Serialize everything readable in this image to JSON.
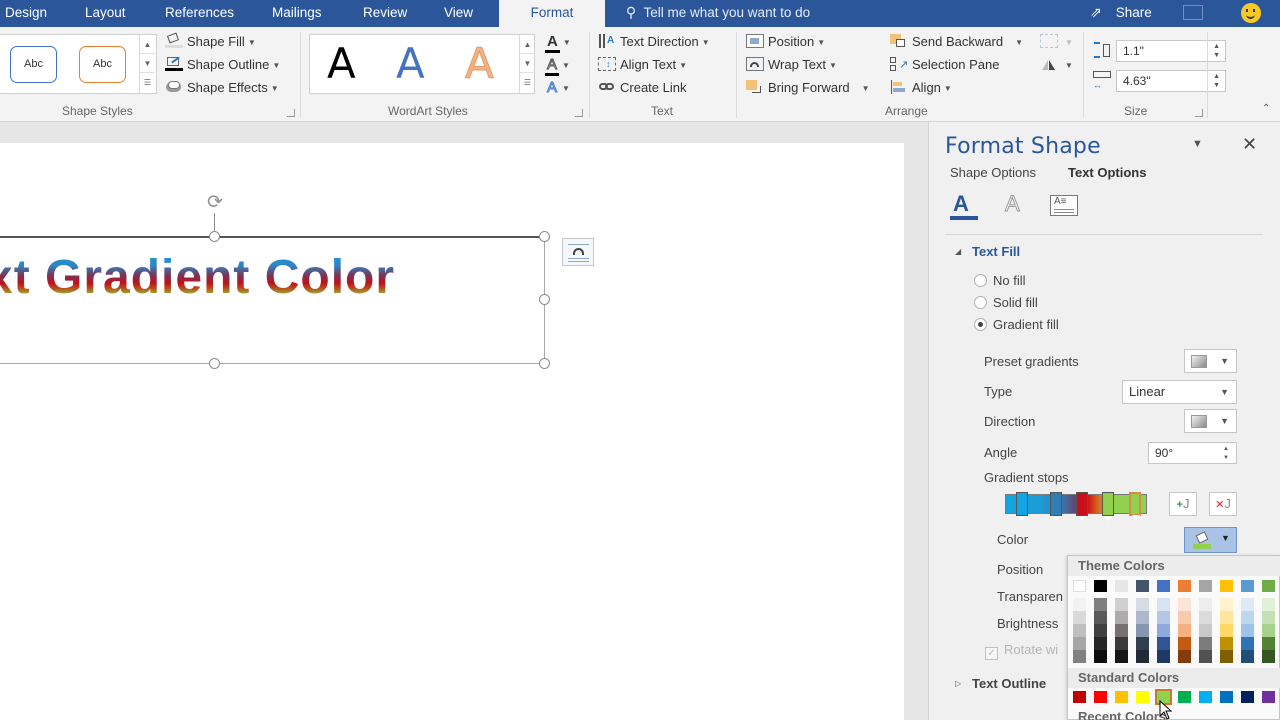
{
  "tabs": [
    {
      "label": "Design",
      "active": false
    },
    {
      "label": "Layout",
      "active": false
    },
    {
      "label": "References",
      "active": false
    },
    {
      "label": "Mailings",
      "active": false
    },
    {
      "label": "Review",
      "active": false
    },
    {
      "label": "View",
      "active": false
    },
    {
      "label": "Format",
      "active": true
    }
  ],
  "tell_me": {
    "placeholder": "Tell me what you want to do",
    "icon": "lightbulb-icon"
  },
  "share": {
    "label": "Share",
    "icon": "share-icon"
  },
  "ribbon": {
    "shape_styles": {
      "label": "Shape Styles",
      "gallery": [
        {
          "text": "Abc",
          "border": "#4472c4"
        },
        {
          "text": "Abc",
          "border": "#ed7d31"
        }
      ],
      "shape_fill": "Shape Fill",
      "shape_outline": "Shape Outline",
      "shape_effects": "Shape Effects"
    },
    "wordart_styles": {
      "label": "WordArt Styles",
      "gallery": [
        {
          "glyph": "A",
          "color": "#000000"
        },
        {
          "glyph": "A",
          "color": "#4472c4"
        },
        {
          "glyph": "A",
          "color": "#f4b183"
        }
      ],
      "text_fill_icon": "A",
      "text_outline_icon": "A",
      "text_effects_icon": "A"
    },
    "text": {
      "label": "Text",
      "text_direction": "Text Direction",
      "align_text": "Align Text",
      "create_link": "Create Link"
    },
    "arrange": {
      "label": "Arrange",
      "position": "Position",
      "wrap_text": "Wrap Text",
      "bring_forward": "Bring Forward",
      "send_backward": "Send Backward",
      "selection_pane": "Selection Pane",
      "align": "Align"
    },
    "size": {
      "label": "Size",
      "height": "1.1\"",
      "width": "4.63\""
    }
  },
  "document": {
    "shape_text": "xt Gradient Color",
    "gradient_colors": [
      "#1aa0dc",
      "#2d86c5",
      "#7a3557",
      "#c0101b",
      "#8cc63f",
      "#92d050"
    ]
  },
  "format_pane": {
    "title": "Format Shape",
    "tabs": [
      {
        "label": "Shape Options",
        "active": false
      },
      {
        "label": "Text Options",
        "active": true
      }
    ],
    "icons": [
      "text-fill-outline-icon",
      "text-effects-icon",
      "textbox-icon"
    ],
    "text_fill": {
      "heading": "Text Fill",
      "options": [
        {
          "label": "No fill",
          "selected": false
        },
        {
          "label": "Solid fill",
          "selected": false
        },
        {
          "label": "Gradient fill",
          "selected": true
        }
      ],
      "preset_gradients_label": "Preset gradients",
      "type_label": "Type",
      "type_value": "Linear",
      "direction_label": "Direction",
      "angle_label": "Angle",
      "angle_value": "90°",
      "gradient_stops_label": "Gradient stops",
      "gradient_stops": [
        {
          "color": "#13a5e3",
          "selected": false
        },
        {
          "color": "#2f7fb6",
          "selected": false
        },
        {
          "color": "#c9101a",
          "selected": false
        },
        {
          "color": "#92d050",
          "selected": false
        },
        {
          "color": "#92d050",
          "selected": true
        }
      ],
      "color_label": "Color",
      "position_label": "Position",
      "transparency_label": "Transparen",
      "brightness_label": "Brightness",
      "rotate_label": "Rotate wi"
    },
    "text_outline": {
      "heading": "Text Outline"
    }
  },
  "color_picker": {
    "theme_heading": "Theme Colors",
    "theme_top": [
      "#ffffff",
      "#000000",
      "#e7e6e6",
      "#44546a",
      "#4472c4",
      "#ed7d31",
      "#a5a5a5",
      "#ffc000",
      "#5b9bd5",
      "#70ad47"
    ],
    "theme_shades": [
      [
        "#f2f2f2",
        "#d9d9d9",
        "#bfbfbf",
        "#a6a6a6",
        "#808080"
      ],
      [
        "#7f7f7f",
        "#595959",
        "#404040",
        "#262626",
        "#0d0d0d"
      ],
      [
        "#d0cece",
        "#aeabab",
        "#757171",
        "#3a3838",
        "#171616"
      ],
      [
        "#d6dce4",
        "#adb9ca",
        "#8496b0",
        "#323f4f",
        "#222a35"
      ],
      [
        "#d9e2f3",
        "#b4c7e7",
        "#8eaadb",
        "#2f5597",
        "#1f3864"
      ],
      [
        "#fbe5d6",
        "#f8cbad",
        "#f4b183",
        "#c55a11",
        "#843c0c"
      ],
      [
        "#ededed",
        "#dbdbdb",
        "#c9c9c9",
        "#7b7b7b",
        "#525252"
      ],
      [
        "#fff2cc",
        "#ffe699",
        "#ffd966",
        "#bf9000",
        "#7f6000"
      ],
      [
        "#deebf7",
        "#bdd7ee",
        "#9dc3e6",
        "#2e75b6",
        "#1f4e79"
      ],
      [
        "#e2f0d9",
        "#c5e0b4",
        "#a9d18e",
        "#548235",
        "#385723"
      ]
    ],
    "standard_heading": "Standard Colors",
    "standard": [
      {
        "color": "#c00000",
        "selected": false
      },
      {
        "color": "#ff0000",
        "selected": false
      },
      {
        "color": "#ffc000",
        "selected": false
      },
      {
        "color": "#ffff00",
        "selected": false
      },
      {
        "color": "#92d050",
        "selected": true
      },
      {
        "color": "#00b050",
        "selected": false
      },
      {
        "color": "#00b0f0",
        "selected": false
      },
      {
        "color": "#0070c0",
        "selected": false
      },
      {
        "color": "#002060",
        "selected": false
      },
      {
        "color": "#7030a0",
        "selected": false
      }
    ],
    "recent_heading": "Recent Colors"
  }
}
